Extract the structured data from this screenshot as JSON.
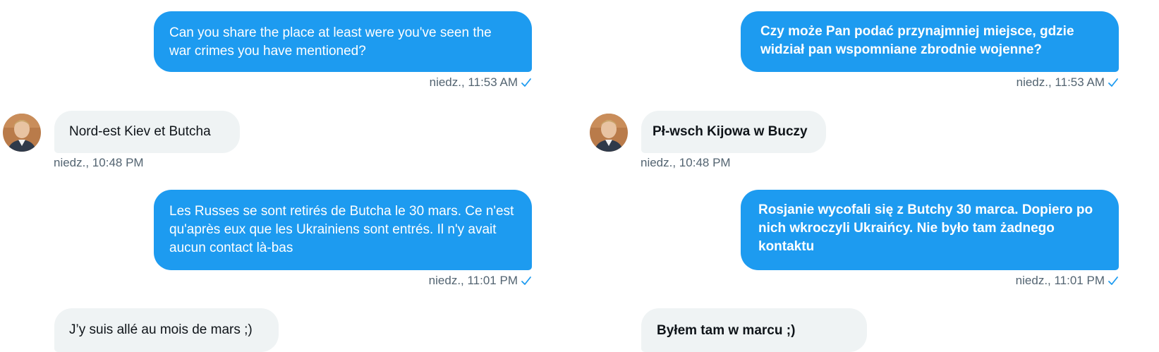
{
  "left": {
    "messages": [
      {
        "direction": "out",
        "text": "Can you share the place at least were you've seen the war crimes you have mentioned?",
        "time": "niedz., 11:53 AM"
      },
      {
        "direction": "in",
        "text": "Nord-est Kiev et Butcha",
        "time": "niedz., 10:48 PM"
      },
      {
        "direction": "out",
        "text": "Les Russes se sont retirés de Butcha le 30 mars. Ce n'est qu'après eux que les Ukrainiens sont entrés. Il n'y avait aucun contact là-bas",
        "time": "niedz., 11:01 PM"
      },
      {
        "direction": "in",
        "text": "J’y suis allé au mois de mars ;)"
      }
    ]
  },
  "right": {
    "messages": [
      {
        "direction": "out",
        "text": "Czy może Pan podać przynajmniej miejsce, gdzie widział pan wspomniane zbrodnie wojenne?",
        "time": "niedz., 11:53 AM"
      },
      {
        "direction": "in",
        "text": "Pł-wsch Kijowa w Buczy",
        "time": "niedz., 10:48 PM"
      },
      {
        "direction": "out",
        "text": "Rosjanie wycofali się z Butchy 30 marca. Dopiero po nich wkroczyli Ukraińcy. Nie było tam żadnego kontaktu",
        "time": "niedz., 11:01 PM"
      },
      {
        "direction": "in",
        "text": "Byłem tam w marcu ;)"
      }
    ]
  },
  "colors": {
    "outgoing_bubble": "#1d9bf0",
    "incoming_bubble": "#eff3f4",
    "timestamp": "#536471",
    "read_check": "#1d9bf0"
  },
  "icons": {
    "read_receipt": "checkmark-icon",
    "avatar": "user-avatar"
  }
}
